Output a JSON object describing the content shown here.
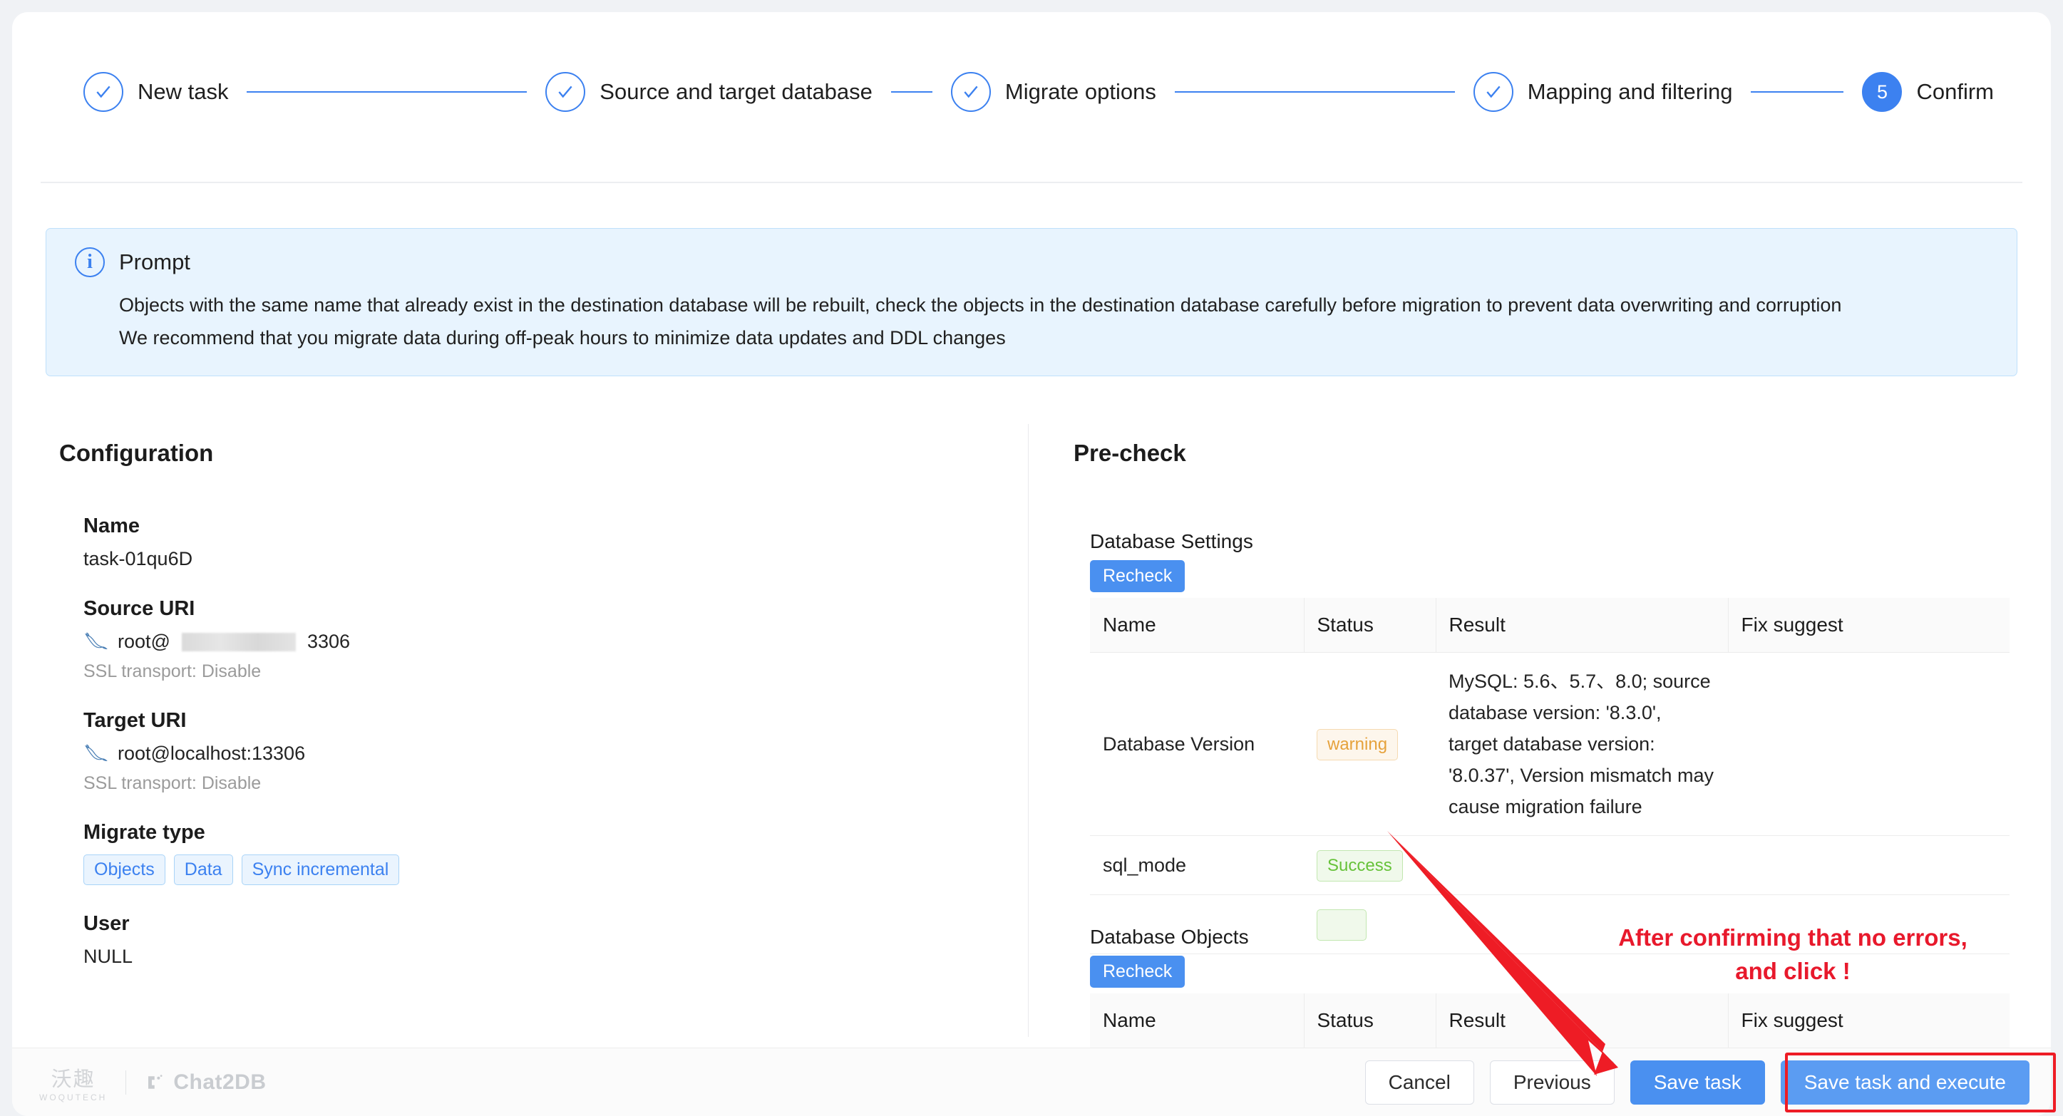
{
  "stepper": {
    "steps": [
      {
        "label": "New task",
        "state": "done",
        "number": "1"
      },
      {
        "label": "Source and target database",
        "state": "done",
        "number": "2"
      },
      {
        "label": "Migrate options",
        "state": "done",
        "number": "3"
      },
      {
        "label": "Mapping and filtering",
        "state": "done",
        "number": "4"
      },
      {
        "label": "Confirm",
        "state": "active",
        "number": "5"
      }
    ]
  },
  "prompt": {
    "title": "Prompt",
    "line1": "Objects with the same name that already exist in the destination database will be rebuilt, check the objects in the destination database carefully before migration to prevent data overwriting and corruption",
    "line2": "We recommend that you migrate data during off-peak hours to minimize data updates and DDL changes"
  },
  "configuration": {
    "title": "Configuration",
    "name_label": "Name",
    "name_value": "task-01qu6D",
    "source_label": "Source URI",
    "source_value_prefix": "root@",
    "source_value_suffix": "3306",
    "source_ssl": "SSL transport: Disable",
    "target_label": "Target URI",
    "target_value": "root@localhost:13306",
    "target_ssl": "SSL transport: Disable",
    "migrate_type_label": "Migrate type",
    "migrate_types": [
      "Objects",
      "Data",
      "Sync incremental"
    ],
    "user_label": "User",
    "user_value": "NULL"
  },
  "precheck": {
    "title": "Pre-check",
    "sections": [
      {
        "title": "Database Settings",
        "recheck_label": "Recheck",
        "columns": [
          "Name",
          "Status",
          "Result",
          "Fix suggest"
        ],
        "rows": [
          {
            "name": "Database Version",
            "status": "warning",
            "status_kind": "warning",
            "result": "MySQL: 5.6、5.7、8.0; source database version: '8.3.0', target database version: '8.0.37', Version mismatch may cause migration failure",
            "fix": ""
          },
          {
            "name": "sql_mode",
            "status": "Success",
            "status_kind": "success",
            "result": "",
            "fix": ""
          }
        ]
      },
      {
        "title": "Database Objects",
        "recheck_label": "Recheck",
        "columns": [
          "Name",
          "Status",
          "Result",
          "Fix suggest"
        ],
        "rows": []
      }
    ]
  },
  "annotation": {
    "line1": "After confirming that no errors,",
    "line2": "and click !",
    "color": "#e8192c"
  },
  "footer": {
    "brand_cn": "沃趣",
    "brand_cn_sub": "WOQUTECH",
    "brand_product": "Chat2DB",
    "cancel_label": "Cancel",
    "previous_label": "Previous",
    "save_label": "Save task",
    "save_execute_label": "Save task and execute"
  }
}
